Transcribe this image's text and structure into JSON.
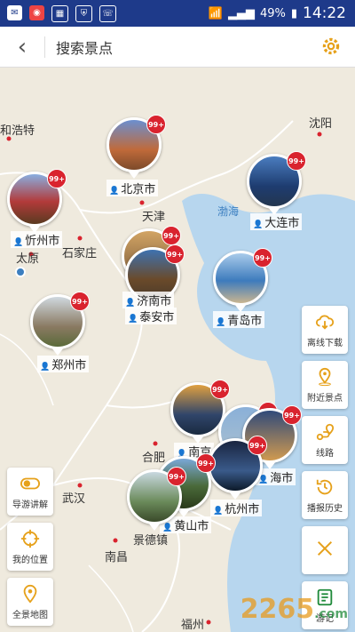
{
  "status": {
    "battery": "49%",
    "time": "14:22"
  },
  "header": {
    "title": "搜索景点"
  },
  "map": {
    "cities": [
      "和浩特",
      "沈阳",
      "天津",
      "石家庄",
      "太原",
      "武汉",
      "合肥",
      "南昌",
      "福州"
    ],
    "seas": [
      "渤海"
    ],
    "pins": [
      {
        "label": "北京市",
        "badge": "99+"
      },
      {
        "label": "忻州市",
        "badge": "99+"
      },
      {
        "label": "大连市",
        "badge": "99+"
      },
      {
        "label": "济南市",
        "badge": "99+"
      },
      {
        "label": "泰安市",
        "badge": "99+"
      },
      {
        "label": "青岛市",
        "badge": "99+"
      },
      {
        "label": "郑州市",
        "badge": "99+"
      },
      {
        "label": "南京",
        "badge": "99+"
      },
      {
        "label": "海市",
        "badge": "99+"
      },
      {
        "label": "杭州市",
        "badge": "99+"
      },
      {
        "label": "黄山市",
        "badge": "99+"
      },
      {
        "label": "景德镇",
        "badge": "99+"
      }
    ]
  },
  "left_buttons": [
    {
      "label": "导游讲解",
      "icon": "toggle-off-icon"
    },
    {
      "label": "我的位置",
      "icon": "crosshair-icon"
    },
    {
      "label": "全景地图",
      "icon": "map-pin-icon"
    }
  ],
  "right_buttons": [
    {
      "label": "离线下载",
      "icon": "cloud-download-icon"
    },
    {
      "label": "附近景点",
      "icon": "nearby-pin-icon"
    },
    {
      "label": "线路",
      "icon": "route-icon"
    },
    {
      "label": "播报历史",
      "icon": "history-icon"
    },
    {
      "label": "",
      "icon": "close-icon"
    },
    {
      "label": "游记",
      "icon": "notes-icon"
    }
  ],
  "watermark": {
    "main": "2265",
    "sub": ".com"
  }
}
